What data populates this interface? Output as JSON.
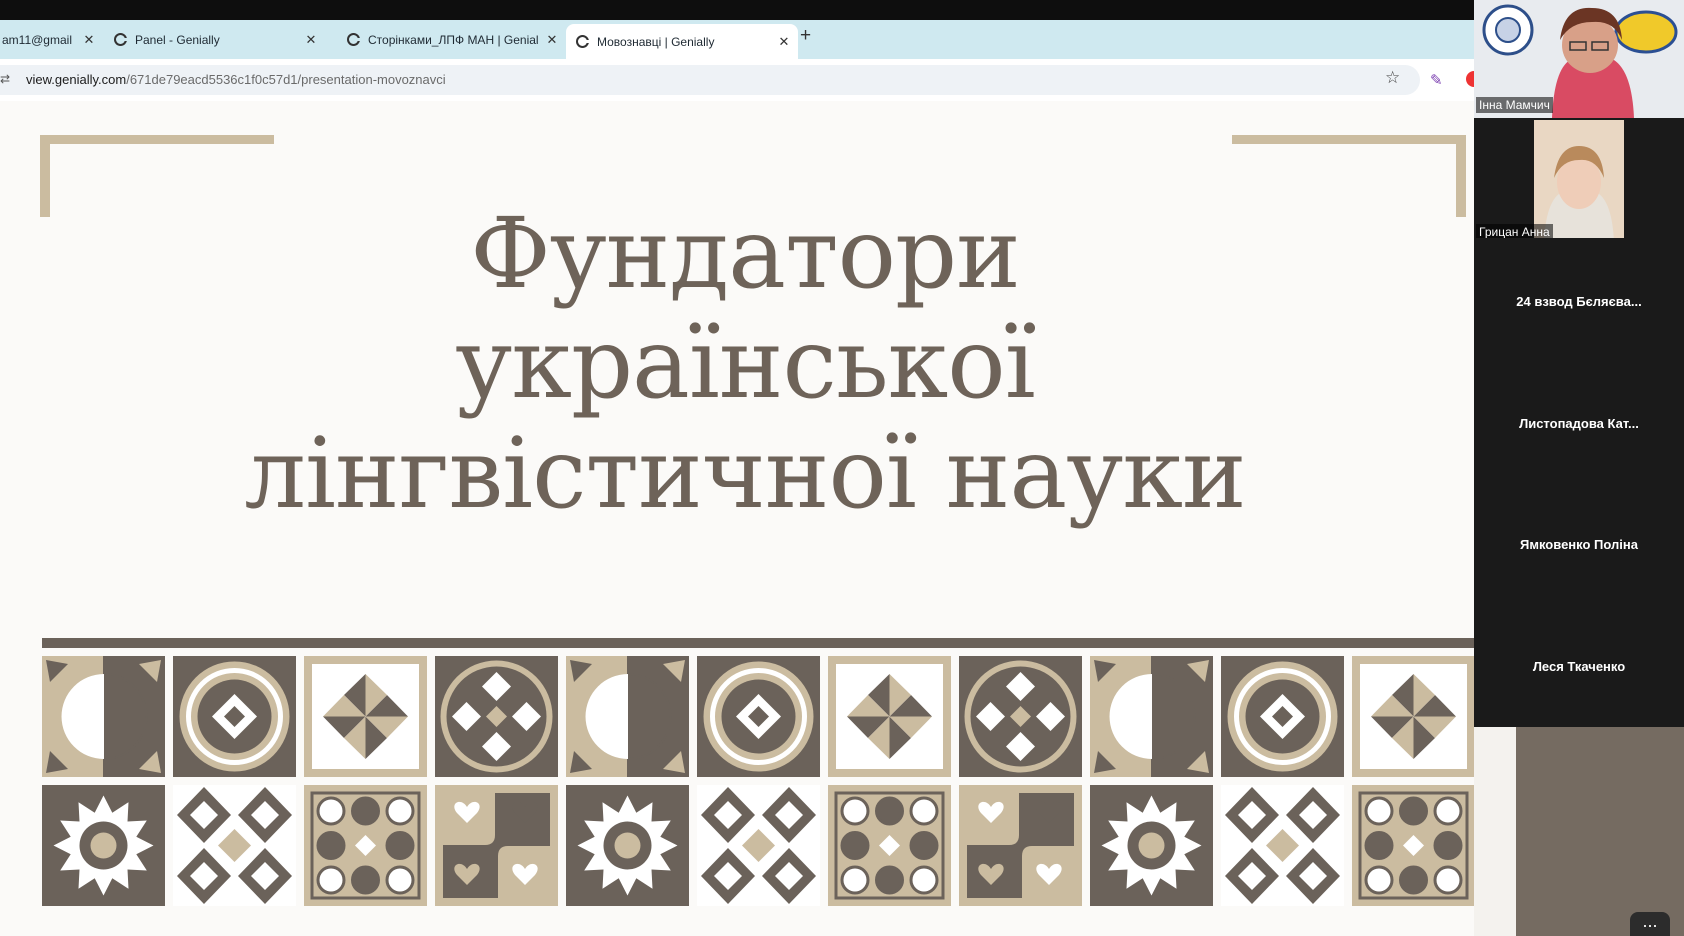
{
  "browser": {
    "tabs": [
      {
        "label": "am11@gmail",
        "close": "✕",
        "active": false
      },
      {
        "label": "Panel - Genially",
        "close": "✕",
        "active": false
      },
      {
        "label": "Сторінками_ЛПФ МАН | Genial",
        "close": "✕",
        "active": false
      },
      {
        "label": "Мовознавці | Genially",
        "close": "✕",
        "active": true
      }
    ],
    "new_tab": "+",
    "url_host": "view.genially.com",
    "url_path": "/671de79eacd5536c1f0c57d1/presentation-movoznavci",
    "star": "☆",
    "site_info": "⇄"
  },
  "slide": {
    "title_lines": [
      "Фундатори",
      "української",
      "лінгвістичної науки"
    ],
    "colors": {
      "dark": "#6b625a",
      "light": "#cbbca0",
      "white": "#ffffff",
      "title": "#6e6359"
    },
    "tiles_row1": [
      "half-moon",
      "circle-diamond",
      "pinwheel",
      "cross-lattice",
      "half-moon",
      "circle-diamond",
      "pinwheel",
      "cross-lattice",
      "half-moon",
      "circle-diamond",
      "pinwheel"
    ],
    "tiles_row2": [
      "sun",
      "diamond-grid",
      "dots",
      "hearts",
      "sun",
      "diamond-grid",
      "dots",
      "hearts",
      "sun",
      "diamond-grid",
      "dots"
    ]
  },
  "participants": [
    {
      "name": "Інна Мамчич"
    },
    {
      "name": "Грицан Анна"
    },
    {
      "name": "24 взвод Бєляєва..."
    },
    {
      "name": "Листопадова  Кат..."
    },
    {
      "name": "Ямковенко Поліна"
    },
    {
      "name": "Леся Ткаченко"
    }
  ],
  "more_button": "..."
}
